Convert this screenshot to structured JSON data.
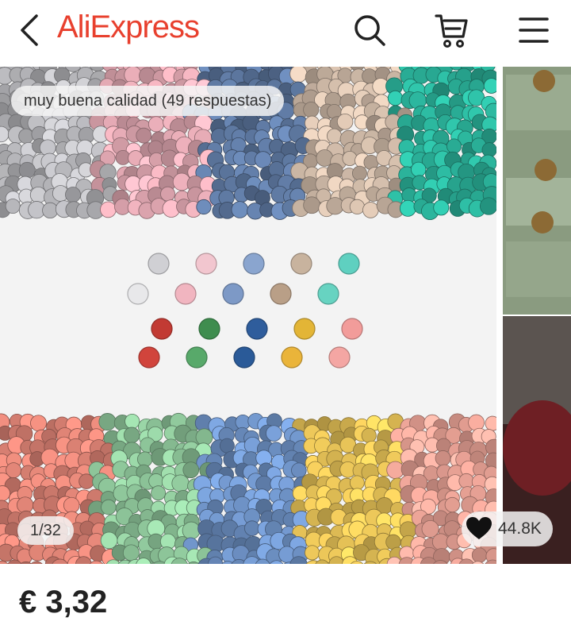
{
  "header": {
    "logo_text": "AliExpress",
    "brand_color": "#e8402e",
    "icons": [
      "chevron-left-icon",
      "search-icon",
      "cart-icon",
      "menu-icon"
    ]
  },
  "gallery": {
    "review_summary": "muy buena calidad (49 respuestas)",
    "page_indicator": "1/32",
    "likes": "44.8K"
  },
  "product": {
    "price": "€ 3,32"
  }
}
